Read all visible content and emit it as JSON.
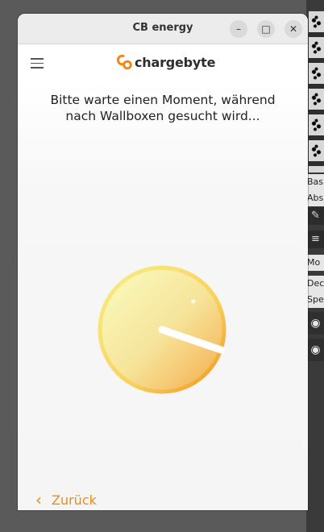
{
  "window": {
    "title": "CB energy",
    "controls": {
      "minimize": "–",
      "maximize": "□",
      "close": "✕"
    }
  },
  "header": {
    "brand": "chargebyte"
  },
  "main": {
    "message_line1": "Bitte warte einen Moment, während",
    "message_line2": "nach Wallboxen gesucht wird..."
  },
  "footer": {
    "back_label": "Zurück"
  },
  "background_app": {
    "labels": [
      "Bas",
      "Abs",
      "Mo",
      "Dec",
      "Sper"
    ]
  },
  "colors": {
    "accent": "#f08a14",
    "spinner_light": "#f7f3a8",
    "spinner_dark": "#f6a93a"
  }
}
